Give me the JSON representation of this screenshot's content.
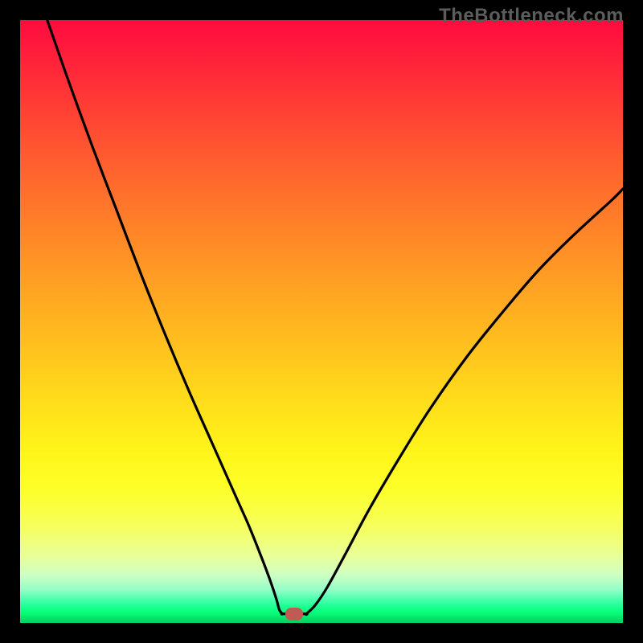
{
  "watermark": "TheBottleneck.com",
  "chart_data": {
    "type": "line",
    "title": "",
    "xlabel": "",
    "ylabel": "",
    "xlim": [
      0,
      100
    ],
    "ylim": [
      0,
      100
    ],
    "grid": false,
    "background": "red-to-green vertical gradient",
    "series": [
      {
        "name": "left-branch",
        "x": [
          4.5,
          8,
          12,
          16,
          20,
          24,
          28,
          32,
          36,
          38,
          40,
          41.5,
          42.5,
          43,
          43.5
        ],
        "y": [
          100,
          90,
          79,
          68.5,
          58,
          48,
          38.5,
          29.5,
          20.5,
          16,
          11,
          7,
          4,
          2.2,
          1.5
        ]
      },
      {
        "name": "flat-bottom",
        "x": [
          43.5,
          45.5,
          47.5
        ],
        "y": [
          1.5,
          1.5,
          1.5
        ]
      },
      {
        "name": "right-branch",
        "x": [
          47.5,
          49,
          51,
          54,
          58,
          63,
          68,
          74,
          80,
          86,
          92,
          98,
          100
        ],
        "y": [
          1.5,
          3,
          6,
          11.5,
          19,
          27.5,
          35.5,
          44,
          51.5,
          58.5,
          64.5,
          70,
          72
        ]
      }
    ],
    "marker": {
      "x": 45.5,
      "y": 1.5,
      "color": "#c05a54"
    },
    "gradient_stops": [
      {
        "pos": 0,
        "color": "#ff0b3e"
      },
      {
        "pos": 0.5,
        "color": "#ffb420"
      },
      {
        "pos": 0.78,
        "color": "#fdff2a"
      },
      {
        "pos": 0.96,
        "color": "#1fff94"
      },
      {
        "pos": 1.0,
        "color": "#06cf61"
      }
    ]
  }
}
